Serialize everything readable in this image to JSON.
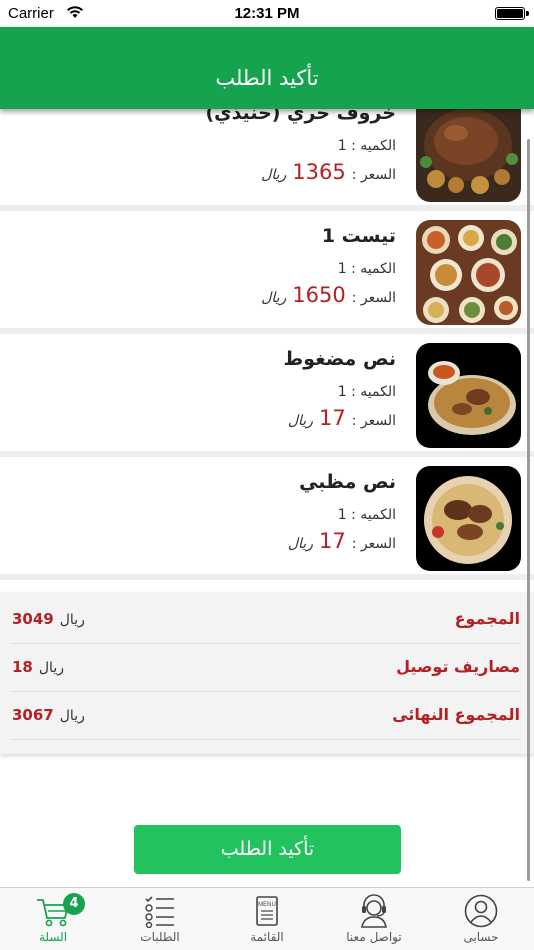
{
  "status_bar": {
    "carrier": "Carrier",
    "time": "12:31 PM"
  },
  "header": {
    "title": "تأكيد الطلب"
  },
  "items": [
    {
      "name": "خروف حري (حنيذي)",
      "qty": "الكميه : 1",
      "price_label": "السعر :",
      "price": "1365",
      "currency": "ريال",
      "image": "roast-lamb-image"
    },
    {
      "name": "تيست 1",
      "qty": "الكميه : 1",
      "price_label": "السعر :",
      "price": "1650",
      "currency": "ريال",
      "image": "food-platter-image"
    },
    {
      "name": "نص مضغوط",
      "qty": "الكميه : 1",
      "price_label": "السعر :",
      "price": "17",
      "currency": "ريال",
      "image": "rice-dish-image"
    },
    {
      "name": "نص مظبي",
      "qty": "الكميه : 1",
      "price_label": "السعر :",
      "price": "17",
      "currency": "ريال",
      "image": "grilled-meat-rice-image"
    }
  ],
  "summary": {
    "total_label": "المجموع",
    "total": "3049",
    "total_currency": "ريال",
    "delivery_label": "مصاريف توصيل",
    "delivery": "18",
    "delivery_currency": "ريال",
    "final_label": "المجموع النهائى",
    "final": "3067",
    "final_currency": "ريال"
  },
  "confirm_button": "تأكيد الطلب",
  "tabs": [
    {
      "label": "حسابى",
      "icon": "user-avatar-icon"
    },
    {
      "label": "تواصل معنا",
      "icon": "headset-support-icon"
    },
    {
      "label": "القائمة",
      "icon": "menu-book-icon"
    },
    {
      "label": "الطلبات",
      "icon": "orders-list-icon"
    },
    {
      "label": "السلة",
      "icon": "cart-icon",
      "badge": "4",
      "active": true
    }
  ],
  "colors": {
    "header": "#16a34e",
    "accent_red": "#b52025",
    "button": "#22c35e"
  }
}
